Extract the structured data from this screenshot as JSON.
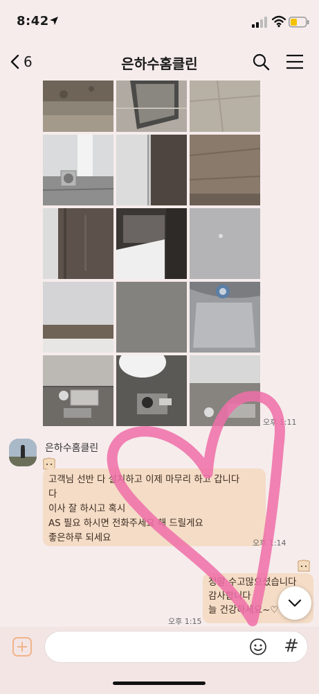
{
  "status_bar": {
    "time": "8:42"
  },
  "header": {
    "back_count": "6",
    "title": "은하수홈클린"
  },
  "photo_album": {
    "photos": [
      "floor-debris",
      "drawer-rail",
      "floor-tile",
      "floor-drain-pipe",
      "wall-panel-grey",
      "wood-panel",
      "dark-wood-panel",
      "drawer-opening",
      "grey-panel-detail",
      "white-wall-trim",
      "grey-panel",
      "steel-sink",
      "bathroom-drain",
      "toilet-base-drain",
      "bathroom-corner-drain"
    ],
    "time": "오후 1:11"
  },
  "incoming": {
    "sender": "은하수홈클린",
    "lines": [
      "고객님 선반 다 설치하고 이제 마무리 하고 갑니다",
      "다",
      "이사 잘 하시고  혹시",
      "AS 필요 하시면 전화주세요 해 드릴게요",
      "좋은하루 되세요"
    ],
    "time": "오후 1:14"
  },
  "outgoing": {
    "lines": [
      "정말 수고많으셨습니다",
      "감사합니다",
      "늘 건강하세요~♡"
    ],
    "time": "오후 1:15"
  },
  "composer": {
    "hash": "#"
  },
  "colors": {
    "background": "#f6ecec",
    "bubble": "#f4dcc6",
    "accent": "#f0b48a",
    "heart": "#ee6fa8"
  }
}
